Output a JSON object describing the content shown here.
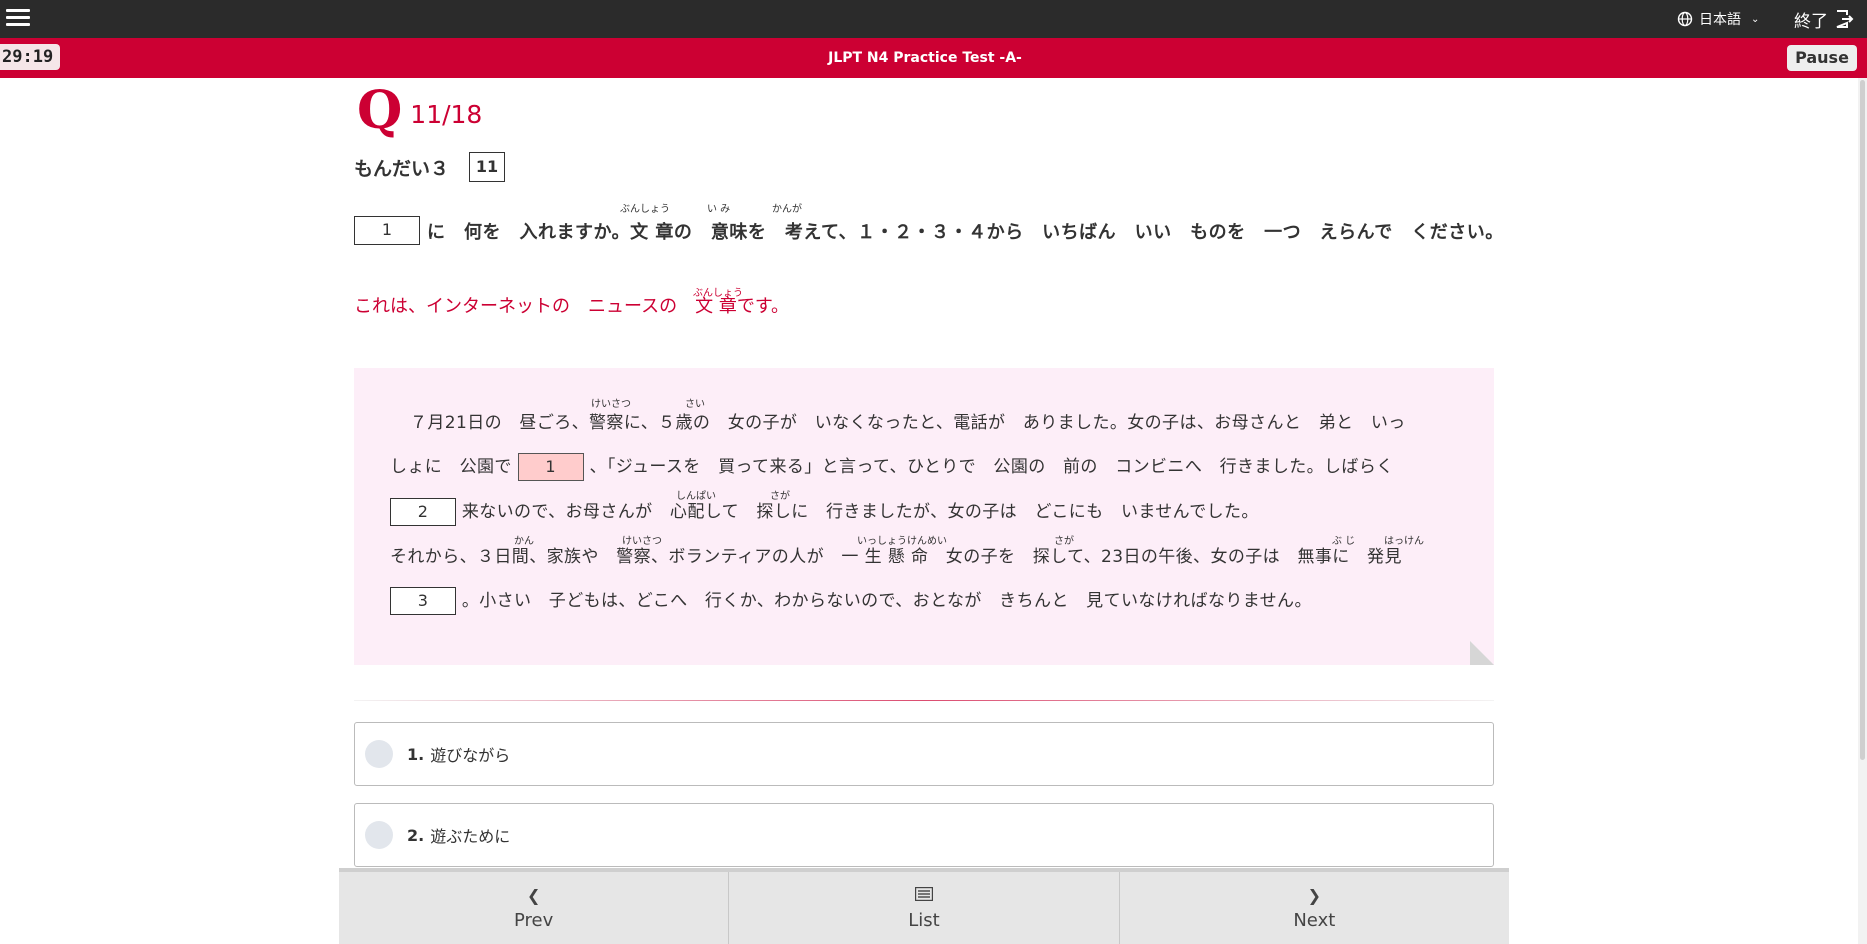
{
  "header": {
    "language": "日本語",
    "finish_label": "終了"
  },
  "subheader": {
    "timer": "29:19",
    "title": "JLPT N4 Practice Test -A-",
    "pause_label": "Pause"
  },
  "question": {
    "q_mark": "Q",
    "counter": "11/18",
    "section": "もんだい３",
    "number": "11",
    "instruction_blank": "1",
    "instruction": "に　何を　入れますか。文 章の　意味を　考えて、１・２・３・４から　いちばん　いい　ものを　一つ　えらんで　ください。",
    "instruction_ruby": {
      "bunsho": "ぶんしょう",
      "imi": "い み",
      "kangae": "かんが"
    },
    "intro": "これは、インターネットの　ニュースの　文 章です。",
    "intro_ruby": "ぶんしょう"
  },
  "passage": {
    "line1": "７月21日の　昼ごろ、警察に、５歳の　女の子が　いなくなったと、電話が　ありました。女の子は、お母さんと　弟と　いっ",
    "line2_a": "しょに　公園で",
    "blank1": "1",
    "line2_b": "、「ジュースを　買って来る」と言って、ひとりで　公園の　前の　コンビニへ　行きました。しばらく",
    "blank2": "2",
    "line3": "来ないので、お母さんが　心配して　探しに　行きましたが、女の子は　どこにも　いませんでした。",
    "line4": "それから、３日間、家族や　警察、ボランティアの人が　一 生 懸 命　女の子を　探して、23日の午後、女の子は　無事に　発見",
    "blank3": "3",
    "line5": "。小さい　子どもは、どこへ　行くか、わからないので、おとなが　きちんと　見ていなければなりません。",
    "ruby": {
      "keisatsu1": "けいさつ",
      "sai": "さい",
      "shinpai": "しんぱい",
      "saga1": "さが",
      "kan": "かん",
      "keisatsu2": "けいさつ",
      "isshoukenmei": "いっしょうけんめい",
      "saga2": "さが",
      "buji": "ぶ じ",
      "hakken": "はっけん"
    }
  },
  "options": [
    {
      "number": "1.",
      "text": "遊びながら"
    },
    {
      "number": "2.",
      "text": "遊ぶために"
    }
  ],
  "nav": {
    "prev_label": "Prev",
    "list_label": "List",
    "next_label": "Next"
  },
  "icons": [
    "menu-icon",
    "globe-icon",
    "chevron-down-icon",
    "exit-icon",
    "chevron-left-icon",
    "list-icon",
    "chevron-right-icon"
  ],
  "colors": {
    "accent": "#cc0033",
    "topbar": "#2b2b2b",
    "passage_bg": "#fdeef8",
    "active_blank": "#ffcccc"
  }
}
